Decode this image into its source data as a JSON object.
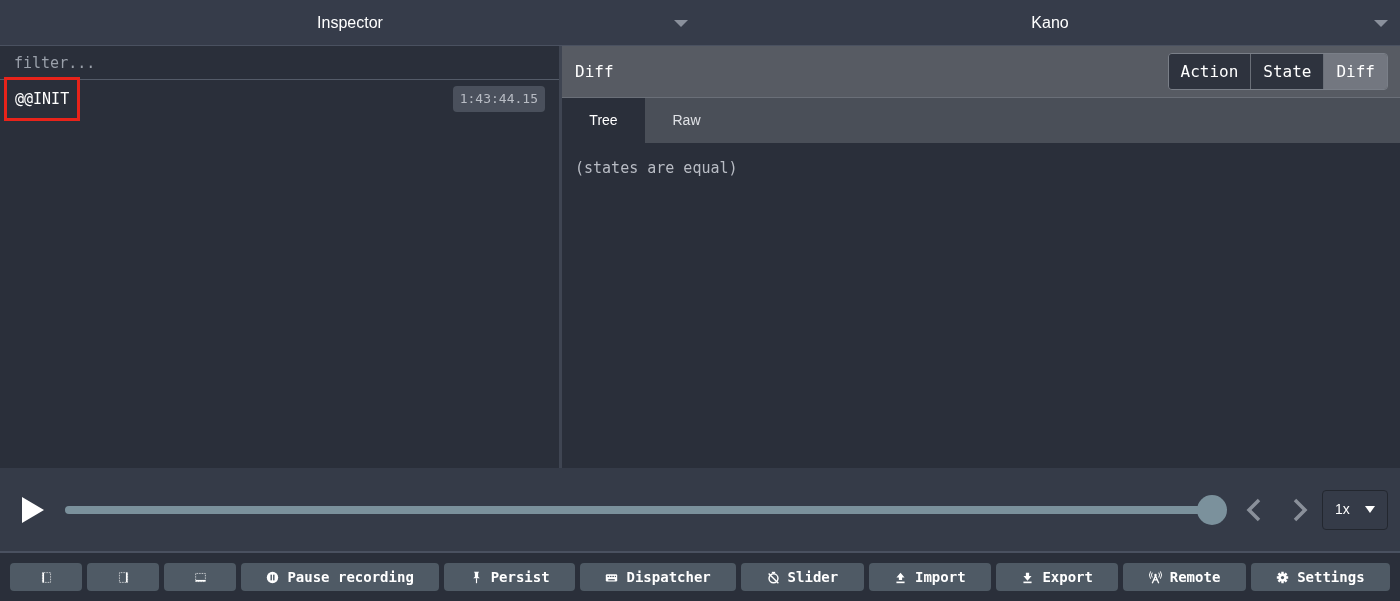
{
  "header": [
    {
      "title": "Inspector"
    },
    {
      "title": "Kano"
    }
  ],
  "filter": {
    "placeholder": "filter..."
  },
  "actions": [
    {
      "name": "@@INIT",
      "time": "1:43:44.15",
      "highlighted": true
    }
  ],
  "detail": {
    "title": "Diff",
    "modes": [
      {
        "label": "Action",
        "selected": false
      },
      {
        "label": "State",
        "selected": false
      },
      {
        "label": "Diff",
        "selected": true
      }
    ],
    "tabs": [
      {
        "label": "Tree",
        "selected": true
      },
      {
        "label": "Raw",
        "selected": false
      }
    ],
    "message": "(states are equal)"
  },
  "player": {
    "level": 1,
    "speed": "1x"
  },
  "toolbar": [
    {
      "kind": "layout-left"
    },
    {
      "kind": "layout-right"
    },
    {
      "kind": "layout-bottom"
    },
    {
      "kind": "pause",
      "label": "Pause recording"
    },
    {
      "kind": "pin",
      "label": "Persist"
    },
    {
      "kind": "keyboard",
      "label": "Dispatcher"
    },
    {
      "kind": "timer",
      "label": "Slider"
    },
    {
      "kind": "upload",
      "label": "Import"
    },
    {
      "kind": "download",
      "label": "Export"
    },
    {
      "kind": "antenna",
      "label": "Remote"
    },
    {
      "kind": "gear",
      "label": "Settings"
    }
  ]
}
